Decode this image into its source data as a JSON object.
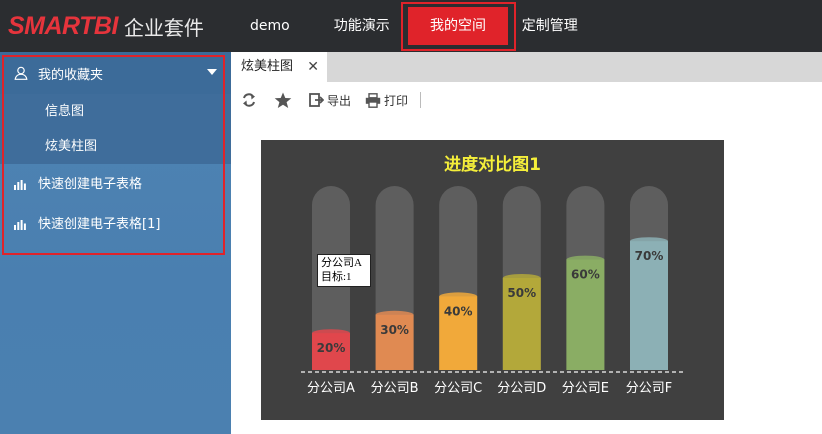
{
  "app": {
    "brand": "SMARTBI",
    "brand_sub": "企业套件"
  },
  "nav": {
    "items": [
      "demo",
      "功能演示",
      "我的空间",
      "定制管理"
    ],
    "active_index": 2
  },
  "sidebar": {
    "favorites_label": "我的收藏夹",
    "sub_items": [
      "信息图",
      "炫美柱图"
    ],
    "tools": [
      "快速创建电子表格",
      "快速创建电子表格[1]"
    ]
  },
  "tabs": {
    "items": [
      {
        "label": "炫美柱图"
      }
    ]
  },
  "toolbar": {
    "refresh_icon": "refresh-icon",
    "favorite_icon": "star-icon",
    "export_label": "导出",
    "print_label": "打印"
  },
  "tooltip": {
    "line1": "分公司A",
    "line2": "目标:1"
  },
  "chart_data": {
    "type": "bar",
    "title": "进度对比图1",
    "categories": [
      "分公司A",
      "分公司B",
      "分公司C",
      "分公司D",
      "分公司E",
      "分公司F"
    ],
    "values": [
      20,
      30,
      40,
      50,
      60,
      70
    ],
    "value_labels": [
      "20%",
      "30%",
      "40%",
      "50%",
      "60%",
      "70%"
    ],
    "target": 100,
    "ylim": [
      0,
      100
    ],
    "colors": [
      "#e0474c",
      "#e08a52",
      "#f1a93a",
      "#b3a83a",
      "#8aad64",
      "#8cb0b5"
    ],
    "track_color": "#5e5e5e",
    "title_color": "#f5ef3a",
    "background": "#404040"
  }
}
